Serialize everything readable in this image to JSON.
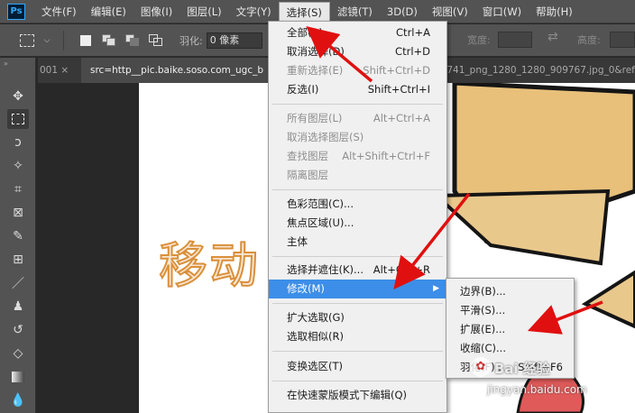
{
  "menubar": {
    "logo": "Ps",
    "items": [
      "文件(F)",
      "编辑(E)",
      "图像(I)",
      "图层(L)",
      "文字(Y)",
      "选择(S)",
      "滤镜(T)",
      "3D(D)",
      "视图(V)",
      "窗口(W)",
      "帮助(H)"
    ],
    "active_index": 5
  },
  "options": {
    "feather_label": "羽化:",
    "feather_value": "0 像素",
    "width_label": "宽度:",
    "height_label": "高度:"
  },
  "tabs": [
    {
      "label": "001 ×"
    },
    {
      "label": "src=http__pic.baike.soso.com_ugc_b"
    },
    {
      "label": "17741_png_1280_1280_909767.jpg_0&ref"
    }
  ],
  "canvas": {
    "text": "移动"
  },
  "select_menu": {
    "items": [
      {
        "label": "全部(A)",
        "shortcut": "Ctrl+A",
        "enabled": true
      },
      {
        "label": "取消选择(D)",
        "shortcut": "Ctrl+D",
        "enabled": true
      },
      {
        "label": "重新选择(E)",
        "shortcut": "Shift+Ctrl+D",
        "enabled": false
      },
      {
        "label": "反选(I)",
        "shortcut": "Shift+Ctrl+I",
        "enabled": true
      },
      {
        "label": "所有图层(L)",
        "shortcut": "Alt+Ctrl+A",
        "enabled": false
      },
      {
        "label": "取消选择图层(S)",
        "shortcut": "",
        "enabled": false
      },
      {
        "label": "查找图层",
        "shortcut": "Alt+Shift+Ctrl+F",
        "enabled": false
      },
      {
        "label": "隔离图层",
        "shortcut": "",
        "enabled": false
      },
      {
        "label": "色彩范围(C)...",
        "shortcut": "",
        "enabled": true
      },
      {
        "label": "焦点区域(U)...",
        "shortcut": "",
        "enabled": true
      },
      {
        "label": "主体",
        "shortcut": "",
        "enabled": true
      },
      {
        "label": "选择并遮住(K)...",
        "shortcut": "Alt+Ctrl+R",
        "enabled": true
      },
      {
        "label": "修改(M)",
        "shortcut": "",
        "enabled": true,
        "submenu": true
      },
      {
        "label": "扩大选取(G)",
        "shortcut": "",
        "enabled": true
      },
      {
        "label": "选取相似(R)",
        "shortcut": "",
        "enabled": true
      },
      {
        "label": "变换选区(T)",
        "shortcut": "",
        "enabled": true
      },
      {
        "label": "在快速蒙版模式下编辑(Q)",
        "shortcut": "",
        "enabled": true
      }
    ]
  },
  "modify_submenu": {
    "items": [
      {
        "label": "边界(B)...",
        "shortcut": ""
      },
      {
        "label": "平滑(S)...",
        "shortcut": ""
      },
      {
        "label": "扩展(E)...",
        "shortcut": ""
      },
      {
        "label": "收缩(C)...",
        "shortcut": ""
      },
      {
        "label": "羽化(F)...",
        "shortcut": "Shift+F6"
      }
    ]
  },
  "watermark": {
    "brand": "Bai 经验",
    "url": "jingyan.baidu.com"
  },
  "colors": {
    "highlight": "#3d8ee8",
    "arrow": "#e01010"
  }
}
